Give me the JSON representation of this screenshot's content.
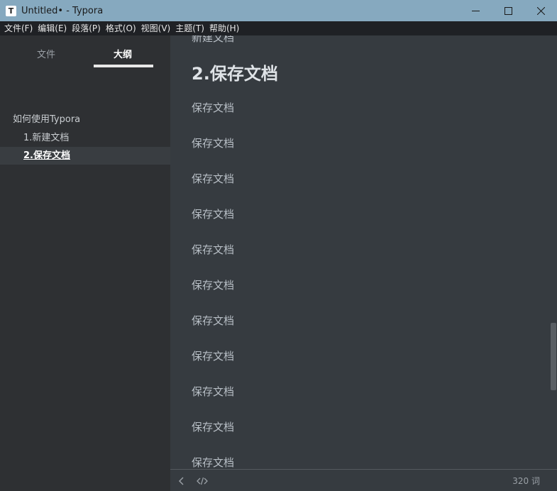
{
  "window": {
    "app_icon_letter": "T",
    "title": "Untitled• - Typora"
  },
  "menu": [
    "文件(F)",
    "编辑(E)",
    "段落(P)",
    "格式(O)",
    "视图(V)",
    "主题(T)",
    "帮助(H)"
  ],
  "sidebar": {
    "tabs": [
      "文件",
      "大纲"
    ],
    "active_tab": "大纲",
    "outline": [
      {
        "label": "如何使用Typora",
        "level": 1
      },
      {
        "label": "1.新建文档",
        "level": 2
      },
      {
        "label": "2.保存文档",
        "level": 2,
        "active": true
      }
    ]
  },
  "editor": {
    "partial_line": "新建文档",
    "heading": "2.保存文档",
    "paragraphs": [
      "保存文档",
      "保存文档",
      "保存文档",
      "保存文档",
      "保存文档",
      "保存文档",
      "保存文档",
      "保存文档",
      "保存文档",
      "保存文档",
      "保存文档"
    ]
  },
  "footer": {
    "word_count": "320 词"
  },
  "colors": {
    "titlebar": "#86a9bf",
    "menubar": "#1f2125",
    "sidebar": "#2e3033",
    "editor": "#363b40"
  }
}
